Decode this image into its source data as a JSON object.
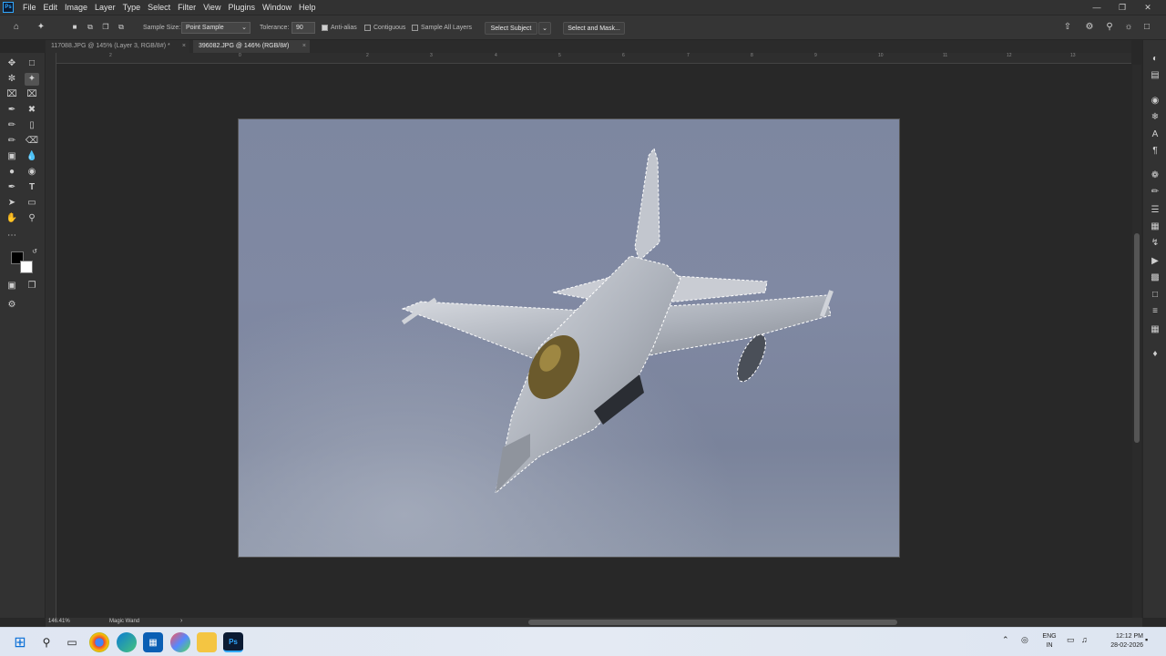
{
  "menubar": {
    "items": [
      "File",
      "Edit",
      "Image",
      "Layer",
      "Type",
      "Select",
      "Filter",
      "View",
      "Plugins",
      "Window",
      "Help"
    ]
  },
  "options": {
    "sample_size_label": "Sample Size:",
    "sample_size_value": "Point Sample",
    "tolerance_label": "Tolerance:",
    "tolerance_value": "90",
    "anti_alias_label": "Anti-alias",
    "anti_alias_checked": true,
    "contiguous_label": "Contiguous",
    "contiguous_checked": false,
    "sample_all_layers_label": "Sample All Layers",
    "sample_all_layers_checked": false,
    "select_subject_label": "Select Subject",
    "select_and_mask_label": "Select and Mask..."
  },
  "tabs": [
    {
      "label": "117088.JPG @ 145% (Layer 3, RGB/8#) *",
      "active": false
    },
    {
      "label": "396082.JPG @ 146% (RGB/8#)",
      "active": true
    }
  ],
  "ruler": {
    "top_ticks": [
      "2",
      "0",
      "2",
      "3",
      "4",
      "5",
      "6",
      "7",
      "8",
      "9",
      "10",
      "11",
      "12",
      "13"
    ]
  },
  "status": {
    "zoom": "146.41%",
    "tool_name": "Magic Wand"
  },
  "taskbar": {
    "lang_line1": "ENG",
    "lang_line2": "IN",
    "time": "12:12 PM",
    "date": "28-02-2026"
  },
  "colors": {
    "accent": "#31a8ff",
    "panel": "#323232",
    "canvas_bg": "#282828"
  }
}
